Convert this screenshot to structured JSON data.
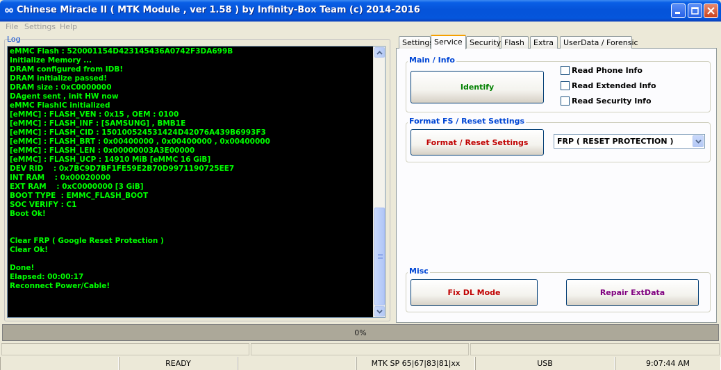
{
  "window": {
    "title": "Chinese Miracle II ( MTK Module , ver 1.58 ) by Infinity-Box Team (c) 2014-2016"
  },
  "menu": [
    "File",
    "Settings",
    "Help"
  ],
  "log": {
    "label": "Log",
    "lines": [
      "eMMC Flash : 520001154D423145436A0742F3DA699B",
      "Initialize Memory ...",
      "DRAM configured from IDB!",
      "DRAM initialize passed!",
      "DRAM size : 0xC0000000",
      "DAgent sent , init HW now",
      "eMMC FlashIC initialized",
      "[eMMC] : FLASH_VEN : 0x15 , OEM : 0100",
      "[eMMC] : FLASH_INF : [SAMSUNG] , BMB1E",
      "[eMMC] : FLASH_CID : 150100524531424D42076A439B6993F3",
      "[eMMC] : FLASH_BRT : 0x00400000 , 0x00400000 , 0x00400000",
      "[eMMC] : FLASH_LEN : 0x00000003A3E00000",
      "[eMMC] : FLASH_UCP : 14910 MiB [eMMC 16 GiB]",
      "DEV RID    : 0x7BC9D7BF1FE59E2B70D9971190725EE7",
      "INT RAM    : 0x00020000",
      "EXT RAM    : 0xC0000000 [3 GiB]",
      "BOOT TYPE  : EMMC_FLASH_BOOT",
      "SOC VERIFY : C1",
      "Boot Ok!",
      "",
      "",
      "Clear FRP ( Google Reset Protection )",
      "Clear Ok!",
      "",
      "Done!",
      "Elapsed: 00:00:17",
      "Reconnect Power/Cable!"
    ]
  },
  "tabs": [
    "Settings",
    "Service",
    "Security",
    "Flash",
    "Extra",
    "UserData / Forensic"
  ],
  "active_tab": "Service",
  "main_info": {
    "label": "Main / Info",
    "identify_button": "Identify",
    "checkboxes": [
      "Read Phone Info",
      "Read Extended Info",
      "Read Security Info"
    ]
  },
  "format_fs": {
    "label": "Format FS / Reset Settings",
    "format_button": "Format / Reset Settings",
    "selected_option": "FRP ( RESET PROTECTION )"
  },
  "misc": {
    "label": "Misc",
    "fix_dl_button": "Fix DL Mode",
    "repair_button": "Repair ExtData"
  },
  "progress": {
    "text": "0%",
    "value": 0
  },
  "status_bar": {
    "state": "READY",
    "platform": "MTK SP 65|67|83|81|xx",
    "connection": "USB",
    "time": "9:07:44 AM"
  },
  "colors": {
    "log_text": "#00ff00",
    "group_label": "#0046d5",
    "identify": "#008000",
    "format": "#c00000",
    "fix_dl": "#c00000",
    "repair": "#800080"
  }
}
